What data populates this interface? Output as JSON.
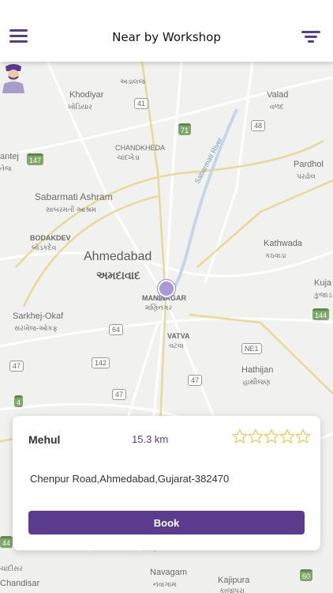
{
  "header": {
    "title": "Near by Workshop"
  },
  "map_labels": {
    "adalaj_gu": "અડાલજ",
    "khodiyar": "Khodiyar",
    "khodiyar_gu": "ખોડિયાર",
    "valad": "Valad",
    "valad_gu": "વળદ",
    "chandkheda": "CHANDKHEDA",
    "chandkheda_gu": "ચાંદખેડા",
    "antej": "antej",
    "antej_gu": "તેજ",
    "river": "Sabarmati River",
    "pardhol": "Pardhol",
    "pardhol_gu": "પરઢોલ",
    "sabarmati_ashram": "Sabarmati Ashram",
    "sabarmati_ashram_gu": "સાબરમતી આશ્રમ",
    "bodakdev": "BODAKDEV",
    "bodakdev_gu": "બોડકદેવ",
    "kathwada": "Kathwada",
    "kathwada_gu": "કઠવાડા",
    "ahmedabad": "Ahmedabad",
    "ahmedabad_gu": "અમદાવાદ",
    "kuja": "Kuja",
    "kuja_gu": "કુજાડ",
    "maninagar": "MANINAGAR",
    "maninagar_gu": "મણિનગર",
    "sarkhej": "Sarkhej-Okaf",
    "sarkhej_gu": "સરખેજ-ઓકફ",
    "vatva": "VATVA",
    "vatva_gu": "વટવા",
    "hathijan": "Hathijan",
    "hathijan_gu": "હાથીજણ",
    "chandisar_gu": "ચાંદીસર",
    "chandisar": "Chandisar",
    "navagam": "Navagam",
    "navagam_gu": "નવાગામ",
    "kajipura": "Kajipura",
    "kajipura_gu": "કાજીપુરા"
  },
  "road_shields": {
    "r41": "41",
    "r71": "71",
    "r48": "48",
    "r147": "147",
    "r64": "64",
    "r142": "142",
    "r47a": "47",
    "r47b": "47",
    "r47c": "47",
    "r4": "4",
    "r144": "144",
    "r44": "44",
    "r60": "60",
    "ne1": "NE1"
  },
  "workshop": {
    "name": "Mehul",
    "distance": "15.3 km",
    "address": "Chenpur Road,Ahmedabad,Gujarat-382470",
    "rating": 0,
    "rating_max": 5,
    "book_label": "Book"
  },
  "colors": {
    "accent": "#5a3b8e",
    "star": "#e9c84a",
    "marker": "#a99ad7"
  }
}
